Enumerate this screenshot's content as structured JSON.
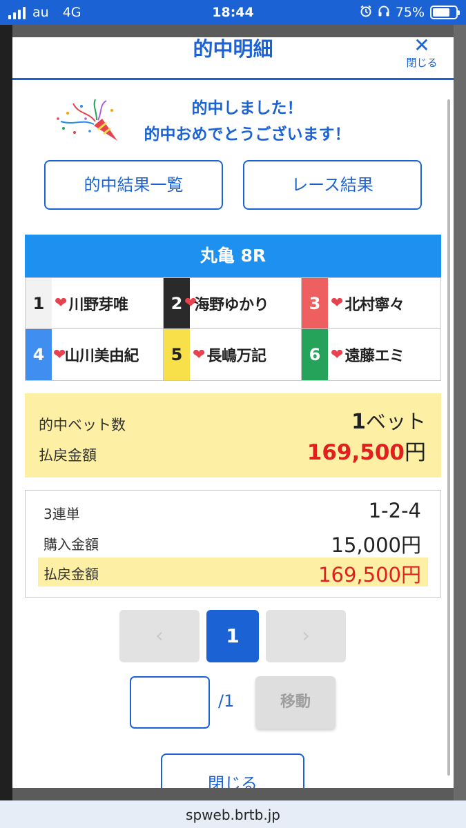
{
  "status_bar": {
    "carrier": "au",
    "network": "4G",
    "time": "18:44",
    "battery": "75%"
  },
  "modal": {
    "title": "的中明細",
    "close_label": "閉じる",
    "congrats_line1": "的中しました！",
    "congrats_line2": "的中おめでとうございます！",
    "buttons": {
      "hit_list": "的中結果一覧",
      "race_result": "レース結果"
    },
    "race": "丸亀 8R",
    "players": [
      {
        "num": "1",
        "name": "川野芽唯",
        "bg": "#f2f2f2",
        "fg": "#222222"
      },
      {
        "num": "2",
        "name": "海野ゆかり",
        "bg": "#2a2a2a",
        "fg": "#ffffff"
      },
      {
        "num": "3",
        "name": "北村寧々",
        "bg": "#ee5f5f",
        "fg": "#ffffff"
      },
      {
        "num": "4",
        "name": "山川美由紀",
        "bg": "#3f8ef0",
        "fg": "#ffffff"
      },
      {
        "num": "5",
        "name": "長嶋万記",
        "bg": "#f7e04a",
        "fg": "#222222"
      },
      {
        "num": "6",
        "name": "遠藤エミ",
        "bg": "#26a35a",
        "fg": "#ffffff"
      }
    ],
    "summary": {
      "bets_label": "的中ベット数",
      "bets_value": "1",
      "bets_unit": "ベット",
      "payout_label": "払戻金額",
      "payout_value": "169,500",
      "payout_unit": "円"
    },
    "detail": {
      "bet_type": "3連単",
      "combination": "1-2-4",
      "purchase_label": "購入金額",
      "purchase_value": "15,000円",
      "payout_label": "払戻金額",
      "payout_value": "169,500円"
    },
    "pager": {
      "prev": "‹",
      "current": "1",
      "next": "›"
    },
    "jump": {
      "total": "/1",
      "move_label": "移動"
    },
    "bottom_close": "閉じる"
  },
  "browser": {
    "url": "spweb.brtb.jp"
  }
}
